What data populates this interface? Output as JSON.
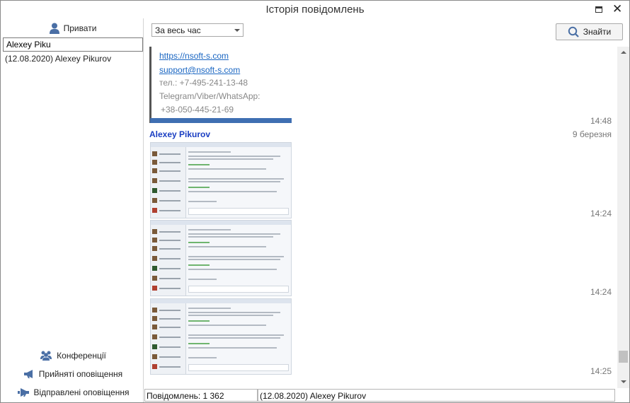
{
  "window": {
    "title": "Історія повідомлень",
    "maximize_icon": "maximize-icon",
    "close_icon": "close-icon",
    "close_glyph": "✕"
  },
  "sidebar": {
    "private_tab": {
      "label": "Привати",
      "icon": "user-icon"
    },
    "search": {
      "value": "Alexey Piku",
      "placeholder": ""
    },
    "contacts": [
      {
        "label": "(12.08.2020) Alexey Pikurov"
      }
    ],
    "conferences_tab": {
      "label": "Конференції",
      "icon": "group-icon"
    },
    "received_tab": {
      "label": "Прийняті оповіщення",
      "icon": "megaphone-in-icon"
    },
    "sent_tab": {
      "label": "Відправлені оповіщення",
      "icon": "megaphone-out-icon"
    }
  },
  "toolbar": {
    "period_select": {
      "value": "За весь час"
    },
    "find_button": {
      "label": "Знайти",
      "icon": "search-icon"
    }
  },
  "messages": {
    "signature": {
      "website": "https://nsoft-s.com",
      "email": "support@nsoft-s.com",
      "phone": "тел.: +7-495-241-13-48",
      "messengers": "Telegram/Viber/WhatsApp:",
      "phone2": "+38-050-445-21-69",
      "time": "14:48"
    },
    "sender": "Alexey Pikurov",
    "date": "9 березня",
    "attachments": [
      {
        "time": "14:24"
      },
      {
        "time": "14:24"
      },
      {
        "time": "14:25"
      }
    ]
  },
  "status": {
    "count": "Повідомлень: 1 362",
    "contact": "(12.08.2020) Alexey Pikurov"
  },
  "colors": {
    "sender_name": "#1a3ec2",
    "link": "#1a66c2",
    "icon_blue": "#4a6fa5",
    "quote_bar": "#3f6fb2"
  }
}
